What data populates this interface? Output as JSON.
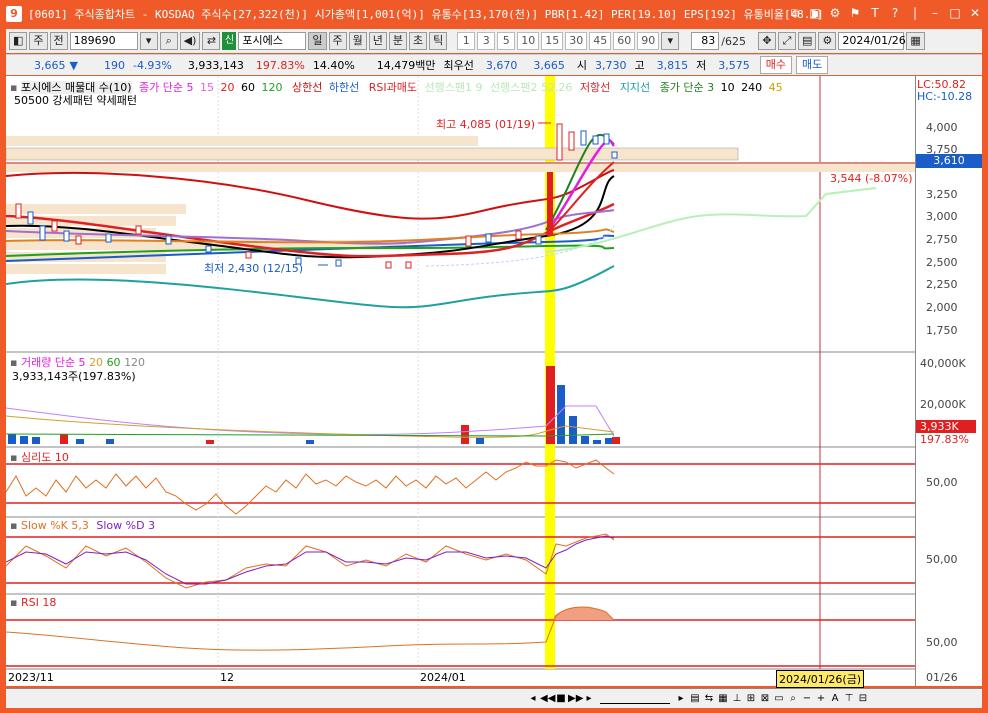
{
  "titlebar": {
    "app_badge": "9",
    "title": "[0601] 주식종합차트 - KOSDAQ 주식수[27,322(천)] 시가총액[1,001(억)] 유통수[13,170(천)] PBR[1.42] PER[19.10] EPS[192] 유통비율[48.2]"
  },
  "toolbar": {
    "type_btn": "주",
    "type_btn2": "전",
    "code": "189690",
    "name_tag": "신",
    "stock_name": "포시에스",
    "periods": [
      "일",
      "주",
      "월",
      "년",
      "분",
      "초",
      "틱"
    ],
    "intervals": [
      "1",
      "3",
      "5",
      "10",
      "15",
      "30",
      "45",
      "60",
      "90"
    ],
    "count": "83",
    "count_total": "/625",
    "date": "2024/01/26"
  },
  "quote": {
    "price": "3,665",
    "arrow": "▼",
    "change": "190",
    "change_pct": "-4.93%",
    "volume": "3,933,143",
    "vol_ratio": "197.83%",
    "turnover": "14.40%",
    "amount": "14,479백만",
    "best_label": "최우선",
    "best1": "3,670",
    "best2": "3,665",
    "open_label": "시",
    "open": "3,730",
    "high_label": "고",
    "high": "3,815",
    "low_label": "저",
    "low": "3,575",
    "buy": "매수",
    "sell": "매도"
  },
  "price_panel": {
    "legend_name": "포시에스 매물대 수(10)",
    "legend_ma": "종가 단순 5",
    "ma_periods": [
      "15",
      "20",
      "60",
      "120"
    ],
    "upper_line": "상한선",
    "lower_line": "하한선",
    "rsi_label": "RSI과매도",
    "span1": "선행스팬1 9",
    "span2": "선행스팬2 52,26",
    "resist": "저항선",
    "support": "지지선",
    "legend_ma2": "종가 단순 3",
    "ma2_periods": [
      "10",
      "240",
      "45"
    ],
    "pattern_label": "50500 강세패턴 약세패턴",
    "high_note": "최고 4,085 (01/19)",
    "low_note": "최저 2,430 (12/15)",
    "right_note": "3,544 (-8.07%)",
    "lc": "LC:50.82",
    "hc": "HC:-10.28",
    "current_price": "3,610",
    "axis": [
      "4,000",
      "3,750",
      "3,500",
      "3,250",
      "3,000",
      "2,750",
      "2,500",
      "2,250",
      "2,000",
      "1,750"
    ]
  },
  "volume_panel": {
    "legend": "거래량 단순 5",
    "ma": [
      "20",
      "60",
      "120"
    ],
    "value": "3,933,143주(197.83%)",
    "axis": [
      "40,000K",
      "20,000K"
    ],
    "badge": "3,933K",
    "badge_pct": "197.83%"
  },
  "psy_panel": {
    "legend": "심리도 10",
    "axis": "50,00"
  },
  "slow_panel": {
    "legend_k": "Slow %K 5,3",
    "legend_d": "Slow %D 3",
    "axis": "50,00"
  },
  "rsi_panel": {
    "legend": "RSI 18",
    "axis": "50,00"
  },
  "dates": {
    "d1": "2023/11",
    "d2": "12",
    "d3": "2024/01",
    "cursor": "2024/01/26(금)",
    "right": "01/26"
  },
  "colors": {
    "accent": "#f05a28",
    "up": "#e0201a",
    "down": "#1a5cc8",
    "highlight": "#ffff00"
  }
}
